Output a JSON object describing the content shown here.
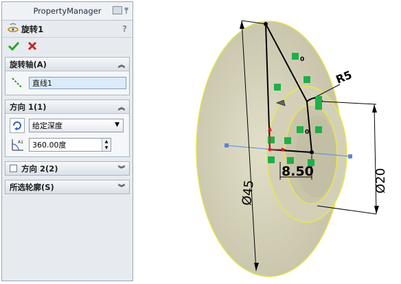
{
  "panel": {
    "title": "PropertyManager",
    "feature_name": "旋转1",
    "help": "?",
    "ok_icon": "check-icon",
    "cancel_icon": "x-icon"
  },
  "axis_group": {
    "title": "旋转轴(A)",
    "axis_value": "直线1"
  },
  "direction1": {
    "title": "方向 1(1)",
    "end_condition": "给定深度",
    "angle": "360.00度",
    "spin_label": "A1"
  },
  "direction2": {
    "title": "方向 2(2)"
  },
  "contours": {
    "title": "所选轮廓(S)"
  },
  "drawing": {
    "dim_r5": "R5",
    "dim_850": "8.50",
    "dim_d45": "Ø45",
    "dim_d20": "Ø20",
    "relation_label": "0",
    "colors": {
      "body": "#cfcbb2",
      "edge": "#e7e745",
      "sketch": "#000000",
      "relation": "#1fae4a"
    }
  }
}
